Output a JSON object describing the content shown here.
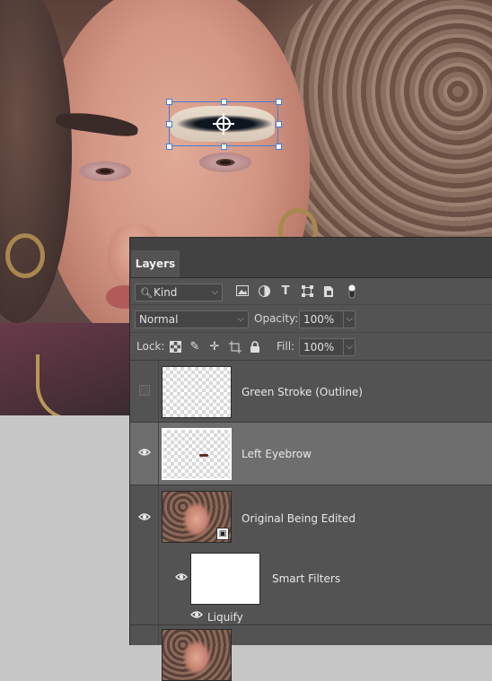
{
  "panel": {
    "tab_label": "Layers",
    "filter": {
      "kind_label": "Kind"
    },
    "filter_icons": [
      "image-filter-icon",
      "adjustment-filter-icon",
      "type-filter-icon",
      "shape-filter-icon",
      "smart-object-filter-icon",
      "filter-toggle-icon"
    ],
    "blend_mode": "Normal",
    "opacity_label": "Opacity:",
    "opacity_value": "100%",
    "lock_label": "Lock:",
    "lock_icons": [
      "lock-transparent-pixels-icon",
      "lock-image-pixels-icon",
      "lock-position-icon",
      "lock-artboard-icon",
      "lock-all-icon"
    ],
    "fill_label": "Fill:",
    "fill_value": "100%"
  },
  "layers": [
    {
      "name": "Green Stroke (Outline)",
      "visible": false,
      "selected": false
    },
    {
      "name": "Left Eyebrow",
      "visible": true,
      "selected": true
    },
    {
      "name": "Original Being Edited",
      "visible": true,
      "selected": false,
      "smart_object": true
    }
  ],
  "smart_filters": {
    "label": "Smart Filters",
    "visible": true,
    "filters": [
      {
        "name": "Liquify",
        "visible": true
      }
    ]
  }
}
